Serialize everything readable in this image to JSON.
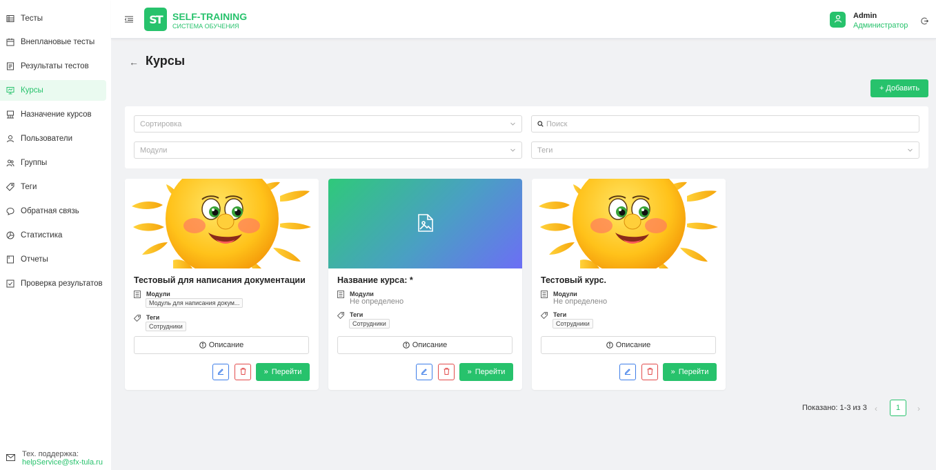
{
  "app": {
    "title": "SELF-TRAINING",
    "subtitle": "СИСТЕМА ОБУЧЕНИЯ",
    "logo_text": "ST",
    "accent": "#27c26c"
  },
  "sidebar": {
    "items": [
      {
        "label": "Тесты",
        "icon": "tests-icon"
      },
      {
        "label": "Внеплановые тесты",
        "icon": "calendar-icon"
      },
      {
        "label": "Результаты тестов",
        "icon": "results-icon"
      },
      {
        "label": "Курсы",
        "icon": "courses-icon",
        "active": true
      },
      {
        "label": "Назначение курсов",
        "icon": "assign-icon"
      },
      {
        "label": "Пользователи",
        "icon": "user-icon"
      },
      {
        "label": "Группы",
        "icon": "group-icon"
      },
      {
        "label": "Теги",
        "icon": "tag-icon"
      },
      {
        "label": "Обратная связь",
        "icon": "feedback-icon"
      },
      {
        "label": "Статистика",
        "icon": "stats-icon"
      },
      {
        "label": "Отчеты",
        "icon": "reports-icon"
      },
      {
        "label": "Проверка результатов",
        "icon": "check-icon"
      }
    ],
    "support_label": "Тех. поддержка:",
    "support_email": "helpService@sfx-tula.ru"
  },
  "header": {
    "user_name": "Admin",
    "user_role": "Администратор"
  },
  "page": {
    "title": "Курсы",
    "add_label": "+ Добавить"
  },
  "filters": {
    "sort_placeholder": "Сортировка",
    "search_placeholder": "Поиск",
    "modules_placeholder": "Модули",
    "tags_placeholder": "Теги"
  },
  "labels": {
    "modules": "Модули",
    "tags": "Теги",
    "description": "Описание",
    "go": "Перейти"
  },
  "courses": [
    {
      "title": "Тестовый для написания документации",
      "image": "sun",
      "module_tag": "Модуль для написания докум...",
      "tag": "Сотрудники"
    },
    {
      "title": "Название курса: *",
      "image": "placeholder",
      "modules_value": "Не определено",
      "tag": "Сотрудники"
    },
    {
      "title": "Тестовый курс.",
      "image": "sun",
      "modules_value": "Не определено",
      "tag": "Сотрудники"
    }
  ],
  "pagination": {
    "summary": "Показано: 1-3 из 3",
    "current_page": "1"
  }
}
